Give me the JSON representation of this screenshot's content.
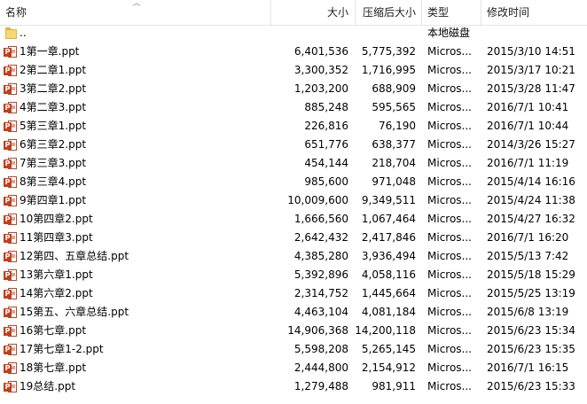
{
  "columns": {
    "name": "名称",
    "size": "大小",
    "compressed": "压缩后大小",
    "type": "类型",
    "modified": "修改时间"
  },
  "icons": {
    "file": "ppt-file-icon",
    "folder": "folder-icon"
  },
  "rows": [
    {
      "name": "..",
      "size": "",
      "compressed": "",
      "type": "本地磁盘",
      "modified": "",
      "icon": "folder"
    },
    {
      "name": "1第一章.ppt",
      "size": "6,401,536",
      "compressed": "5,775,392",
      "type": "Micros...",
      "modified": "2015/3/10 14:51",
      "icon": "ppt"
    },
    {
      "name": "2第二章1.ppt",
      "size": "3,300,352",
      "compressed": "1,716,995",
      "type": "Micros...",
      "modified": "2015/3/17 10:21",
      "icon": "ppt"
    },
    {
      "name": "3第二章2.ppt",
      "size": "1,203,200",
      "compressed": "688,909",
      "type": "Micros...",
      "modified": "2015/3/28 11:47",
      "icon": "ppt"
    },
    {
      "name": "4第二章3.ppt",
      "size": "885,248",
      "compressed": "595,565",
      "type": "Micros...",
      "modified": "2016/7/1 10:41",
      "icon": "ppt"
    },
    {
      "name": "5第三章1.ppt",
      "size": "226,816",
      "compressed": "76,190",
      "type": "Micros...",
      "modified": "2016/7/1 10:44",
      "icon": "ppt"
    },
    {
      "name": "6第三章2.ppt",
      "size": "651,776",
      "compressed": "638,377",
      "type": "Micros...",
      "modified": "2014/3/26 15:27",
      "icon": "ppt"
    },
    {
      "name": "7第三章3.ppt",
      "size": "454,144",
      "compressed": "218,704",
      "type": "Micros...",
      "modified": "2016/7/1 11:19",
      "icon": "ppt"
    },
    {
      "name": "8第三章4.ppt",
      "size": "985,600",
      "compressed": "971,048",
      "type": "Micros...",
      "modified": "2015/4/14 16:16",
      "icon": "ppt"
    },
    {
      "name": "9第四章1.ppt",
      "size": "10,009,600",
      "compressed": "9,349,511",
      "type": "Micros...",
      "modified": "2015/4/24 11:38",
      "icon": "ppt"
    },
    {
      "name": "10第四章2.ppt",
      "size": "1,666,560",
      "compressed": "1,067,464",
      "type": "Micros...",
      "modified": "2015/4/27 16:32",
      "icon": "ppt"
    },
    {
      "name": "11第四章3.ppt",
      "size": "2,642,432",
      "compressed": "2,417,846",
      "type": "Micros...",
      "modified": "2016/7/1 16:20",
      "icon": "ppt"
    },
    {
      "name": "12第四、五章总结.ppt",
      "size": "4,385,280",
      "compressed": "3,936,494",
      "type": "Micros...",
      "modified": "2015/5/13 7:42",
      "icon": "ppt"
    },
    {
      "name": "13第六章1.ppt",
      "size": "5,392,896",
      "compressed": "4,058,116",
      "type": "Micros...",
      "modified": "2015/5/18 15:29",
      "icon": "ppt"
    },
    {
      "name": "14第六章2.ppt",
      "size": "2,314,752",
      "compressed": "1,445,664",
      "type": "Micros...",
      "modified": "2015/5/25 13:19",
      "icon": "ppt"
    },
    {
      "name": "15第五、六章总结.ppt",
      "size": "4,463,104",
      "compressed": "4,081,184",
      "type": "Micros...",
      "modified": "2015/6/8 13:19",
      "icon": "ppt"
    },
    {
      "name": "16第七章.ppt",
      "size": "14,906,368",
      "compressed": "14,200,118",
      "type": "Micros...",
      "modified": "2015/6/23 15:34",
      "icon": "ppt"
    },
    {
      "name": "17第七章1-2.ppt",
      "size": "5,598,208",
      "compressed": "5,265,145",
      "type": "Micros...",
      "modified": "2015/6/23 15:35",
      "icon": "ppt"
    },
    {
      "name": "18第七章.ppt",
      "size": "2,444,800",
      "compressed": "2,154,912",
      "type": "Micros...",
      "modified": "2016/7/1 16:15",
      "icon": "ppt"
    },
    {
      "name": "19总结.ppt",
      "size": "1,279,488",
      "compressed": "981,911",
      "type": "Micros...",
      "modified": "2015/6/23 15:33",
      "icon": "ppt"
    }
  ]
}
